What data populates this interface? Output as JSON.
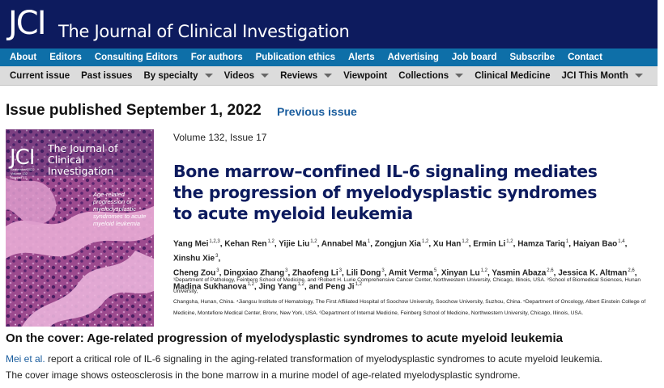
{
  "header": {
    "logo_text": "JCI",
    "journal_name": "The Journal of Clinical Investigation",
    "brand_color": "#0d1b5e"
  },
  "primary_nav": [
    "About",
    "Editors",
    "Consulting Editors",
    "For authors",
    "Publication ethics",
    "Alerts",
    "Advertising",
    "Job board",
    "Subscribe",
    "Contact"
  ],
  "secondary_nav": [
    {
      "label": "Current issue",
      "dropdown": false
    },
    {
      "label": "Past issues",
      "dropdown": false
    },
    {
      "label": "By specialty",
      "dropdown": true
    },
    {
      "label": "Videos",
      "dropdown": true
    },
    {
      "label": "Reviews",
      "dropdown": true
    },
    {
      "label": "Viewpoint",
      "dropdown": false
    },
    {
      "label": "Collections",
      "dropdown": true
    },
    {
      "label": "Clinical Medicine",
      "dropdown": false
    },
    {
      "label": "JCI This Month",
      "dropdown": true
    }
  ],
  "issue": {
    "heading": "Issue published September 1, 2022",
    "previous_link": "Previous issue",
    "volume": "Volume 132, Issue 17"
  },
  "cover_image": {
    "logo": "JCI",
    "journal": "The Journal of Clinical Investigation",
    "meta": "September 2022 Volume 132 Number 17",
    "caption": "Age-related progression of myelodysplastic syndromes to acute myeloid leukemia"
  },
  "article": {
    "title": "Bone marrow–confined IL-6 signaling mediates the progression of myelodysplastic syndromes to acute myeloid leukemia",
    "authors_lines": [
      [
        [
          "Yang Mei,",
          "1,2,3"
        ],
        [
          "Kehan Ren,",
          "1,2"
        ],
        [
          "Yijie Liu,",
          "1,2"
        ],
        [
          "Annabel Ma,",
          "1"
        ],
        [
          "Zongjun Xia,",
          "1,2"
        ],
        [
          "Xu Han,",
          "1,2"
        ],
        [
          "Ermin Li,",
          "1,2"
        ],
        [
          "Hamza Tariq,",
          "1"
        ],
        [
          "Haiyan Bao,",
          "1,4"
        ],
        [
          "Xinshu Xie,",
          "3"
        ]
      ],
      [
        [
          "Cheng Zou,",
          "3"
        ],
        [
          "Dingxiao Zhang,",
          "3"
        ],
        [
          "Zhaofeng Li,",
          "3"
        ],
        [
          "Lili Dong,",
          "3"
        ],
        [
          "Amit Verma,",
          "5"
        ],
        [
          "Xinyan Lu,",
          "1,2"
        ],
        [
          "Yasmin Abaza,",
          "2,6"
        ],
        [
          "Jessica K. Altman,",
          "2,6"
        ]
      ],
      [
        [
          "Madina Sukhanova,",
          "1,2"
        ],
        [
          "Jing Yang,",
          "1,2"
        ],
        [
          "and Peng Ji",
          "1,2"
        ]
      ]
    ],
    "affiliations": [
      "¹Department of Pathology, Feinberg School of Medicine, and ²Robert H. Lurie Comprehensive Cancer Center, Northwestern University, Chicago, Illinois, USA. ³School of Biomedical Sciences, Hunan University,",
      "Changsha, Hunan, China. ⁴Jiangsu Institute of Hematology, The First Affiliated Hospital of Soochow University, Soochow University, Suzhou, China. ⁵Department of Oncology, Albert Einstein College of",
      "Medicine, Montefiore Medical Center, Bronx, New York, USA. ⁶Department of Internal Medicine, Feinberg School of Medicine, Northwestern University, Chicago, Illinois, USA."
    ]
  },
  "on_the_cover": {
    "heading": "On the cover: Age-related progression of myelodysplastic syndromes to acute myeloid leukemia",
    "link_text": "Mei et al.",
    "text_part1": " report a critical role of IL-6 signaling in the aging-related transformation of myelodysplastic syndromes to acute myeloid leukemia.",
    "text_part2": "The cover image shows osteosclerosis in the bone marrow in a murine model of age-related myelodysplastic syndrome."
  }
}
